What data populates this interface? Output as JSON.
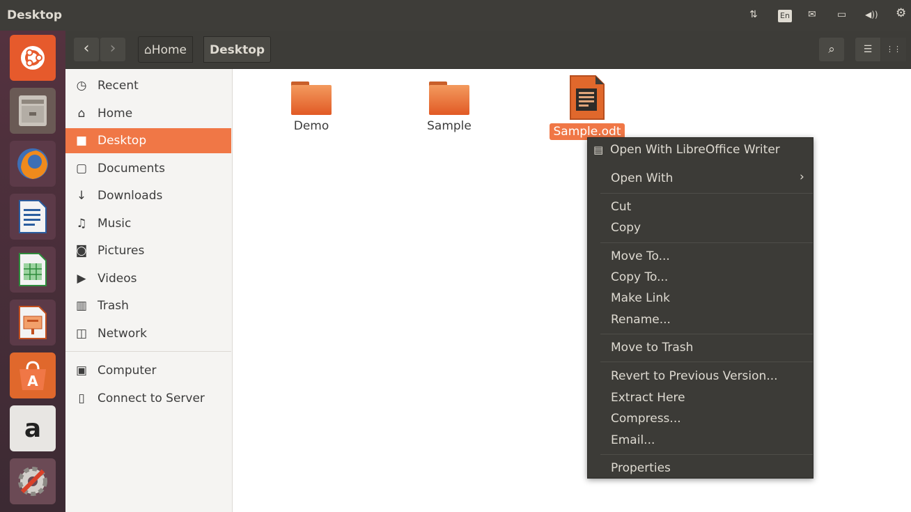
{
  "window": {
    "title": "Desktop"
  },
  "tray": {
    "network": "⇅",
    "keyboard": "En",
    "mail": "✉",
    "battery": "▭",
    "volume": "◀))",
    "settings": "⚙"
  },
  "launcher": {
    "items": [
      "ubuntu-dash-icon",
      "files-icon",
      "firefox-icon",
      "libreoffice-writer-icon",
      "libreoffice-calc-icon",
      "libreoffice-impress-icon",
      "software-center-icon",
      "amazon-icon",
      "system-settings-icon"
    ],
    "amazon_glyph": "a"
  },
  "toolbar": {
    "back": "‹",
    "forward": "›",
    "home_crumb": "Home",
    "current_crumb": "Desktop",
    "search": "⌕",
    "list_view": "☰",
    "grid_view": "⋮⋮"
  },
  "sidebar": {
    "items": [
      {
        "label": "Recent",
        "icon": "clock-icon",
        "glyph": "◷"
      },
      {
        "label": "Home",
        "icon": "home-icon",
        "glyph": "⌂"
      },
      {
        "label": "Desktop",
        "icon": "folder-icon",
        "glyph": "■"
      },
      {
        "label": "Documents",
        "icon": "document-icon",
        "glyph": "▢"
      },
      {
        "label": "Downloads",
        "icon": "download-icon",
        "glyph": "↓"
      },
      {
        "label": "Music",
        "icon": "music-icon",
        "glyph": "♫"
      },
      {
        "label": "Pictures",
        "icon": "camera-icon",
        "glyph": "◙"
      },
      {
        "label": "Videos",
        "icon": "video-icon",
        "glyph": "▶"
      },
      {
        "label": "Trash",
        "icon": "trash-icon",
        "glyph": "▥"
      },
      {
        "label": "Network",
        "icon": "network-icon",
        "glyph": "◫"
      },
      {
        "label": "Computer",
        "icon": "computer-icon",
        "glyph": "▣"
      },
      {
        "label": "Connect to Server",
        "icon": "server-icon",
        "glyph": "▯"
      }
    ],
    "selected": "Desktop"
  },
  "files": [
    {
      "name": "Demo",
      "type": "folder"
    },
    {
      "name": "Sample",
      "type": "folder"
    },
    {
      "name": "Sample.odt",
      "type": "odt-document",
      "selected": true
    }
  ],
  "context_menu": {
    "items": [
      {
        "label": "Open With LibreOffice Writer",
        "icon": "document-icon"
      },
      {
        "label": "Open With",
        "submenu": "›"
      },
      {
        "label": "Cut"
      },
      {
        "label": "Copy"
      },
      {
        "label": "Move To..."
      },
      {
        "label": "Copy To..."
      },
      {
        "label": "Make Link"
      },
      {
        "label": "Rename..."
      },
      {
        "label": "Move to Trash"
      },
      {
        "label": "Revert to Previous Version..."
      },
      {
        "label": "Extract Here"
      },
      {
        "label": "Compress..."
      },
      {
        "label": "Email..."
      },
      {
        "label": "Properties"
      }
    ]
  },
  "colors": {
    "accent": "#f07746",
    "dark": "#3c3b37",
    "launcher": "#4a2f3a"
  }
}
